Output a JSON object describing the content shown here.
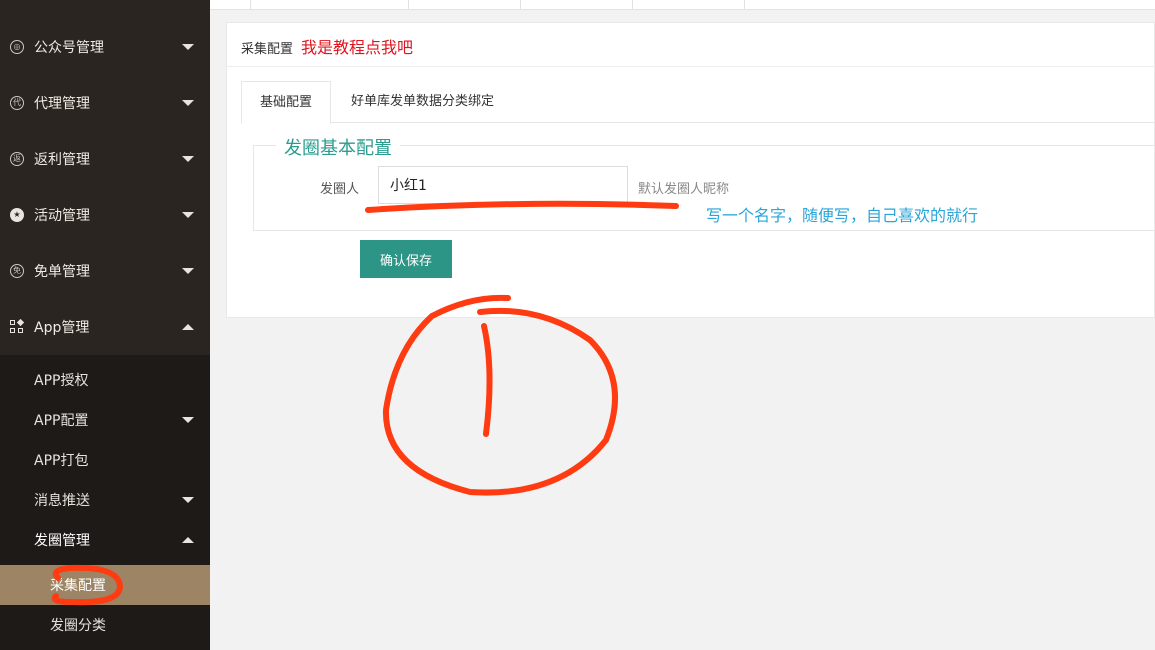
{
  "sidebar": {
    "menus": [
      {
        "label": "公众号管理",
        "icon": "wechat-icon"
      },
      {
        "label": "代理管理",
        "icon": "agent-icon"
      },
      {
        "label": "返利管理",
        "icon": "rebate-icon"
      },
      {
        "label": "活动管理",
        "icon": "star-icon"
      },
      {
        "label": "免单管理",
        "icon": "free-icon"
      },
      {
        "label": "App管理",
        "icon": "apps-icon"
      }
    ],
    "sub": [
      {
        "label": "APP授权"
      },
      {
        "label": "APP配置"
      },
      {
        "label": "APP打包"
      },
      {
        "label": "消息推送"
      },
      {
        "label": "发圈管理"
      }
    ],
    "sub2": [
      {
        "label": "采集配置"
      },
      {
        "label": "发圈分类"
      }
    ]
  },
  "card": {
    "title": "采集配置",
    "tutorial_link": "我是教程点我吧",
    "tabs": [
      {
        "label": "基础配置"
      },
      {
        "label": "好单库发单数据分类绑定"
      }
    ],
    "legend": "发圈基本配置",
    "field_label": "发圈人",
    "field_value": "小红1",
    "field_hint": "默认发圈人昵称",
    "save_label": "确认保存"
  },
  "annotation": {
    "note": "写一个名字，随便写，自己喜欢的就行"
  },
  "colors": {
    "sidebar_bg": "#2b2521",
    "submenu_bg": "#1e1a17",
    "active_item": "#9c8465",
    "accent": "#2d9585",
    "link_red": "#e0141e",
    "annotation_blue": "#29a5d8",
    "marker": "#ff3b12"
  }
}
